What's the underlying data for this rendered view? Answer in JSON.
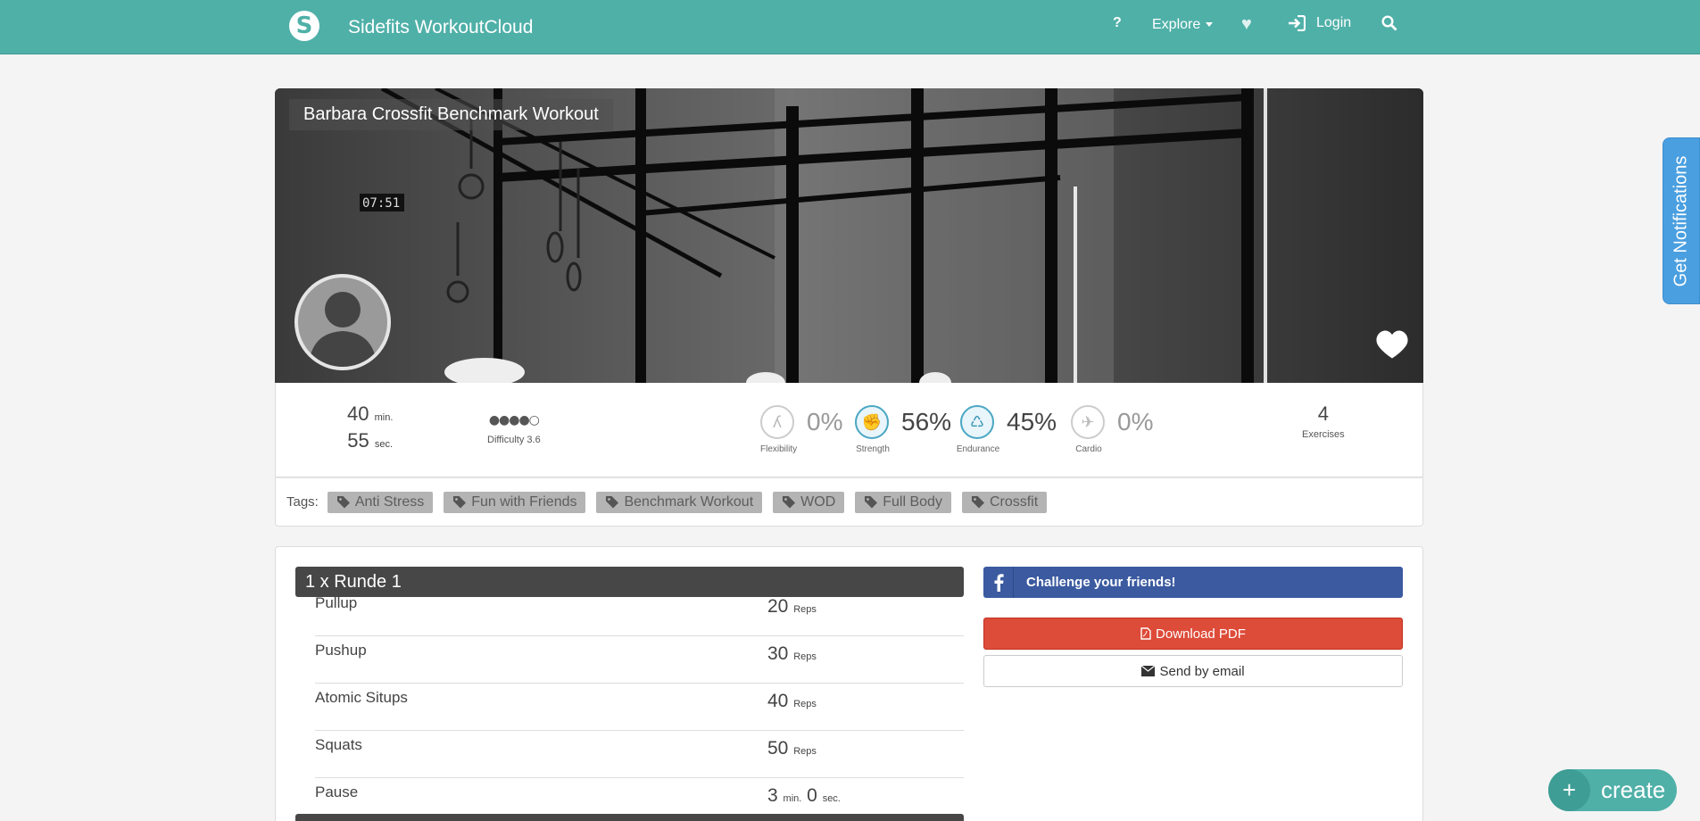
{
  "app": {
    "brand": "Sidefits WorkoutCloud",
    "logo_letter": "S",
    "accent": "#4fb0a8"
  },
  "nav": {
    "help": "?",
    "explore": "Explore",
    "login": "Login"
  },
  "workout": {
    "title": "Barbara Crossfit Benchmark Workout",
    "duration": {
      "min": "40",
      "min_unit": "min.",
      "sec": "55",
      "sec_unit": "sec."
    },
    "difficulty": {
      "dots": "●●●●○",
      "label": "Difficulty 3.6"
    },
    "metrics": [
      {
        "label": "Flexibility",
        "value": "0%",
        "icon": "flexibility-icon"
      },
      {
        "label": "Strength",
        "value": "56%",
        "icon": "strength-icon"
      },
      {
        "label": "Endurance",
        "value": "45%",
        "icon": "endurance-icon"
      },
      {
        "label": "Cardio",
        "value": "0%",
        "icon": "cardio-icon"
      }
    ],
    "exercises_count": "4",
    "exercises_label": "Exercises"
  },
  "tags": {
    "label": "Tags:",
    "items": [
      "Anti Stress",
      "Fun with Friends",
      "Benchmark Workout",
      "WOD",
      "Full Body",
      "Crossfit"
    ]
  },
  "round": {
    "title": "1 x Runde 1",
    "exercises": [
      {
        "name": "Pullup",
        "value": "20",
        "unit": "Reps"
      },
      {
        "name": "Pushup",
        "value": "30",
        "unit": "Reps"
      },
      {
        "name": "Atomic Situps",
        "value": "40",
        "unit": "Reps"
      },
      {
        "name": "Squats",
        "value": "50",
        "unit": "Reps"
      },
      {
        "name": "Pause",
        "value": "3",
        "unit": "min.",
        "value2": "0",
        "unit2": "sec."
      }
    ]
  },
  "actions": {
    "challenge": "Challenge your friends!",
    "pdf": "Download PDF",
    "email": "Send by email"
  },
  "notifications": "Get Notifications",
  "fab": {
    "plus": "+",
    "label": "create"
  }
}
